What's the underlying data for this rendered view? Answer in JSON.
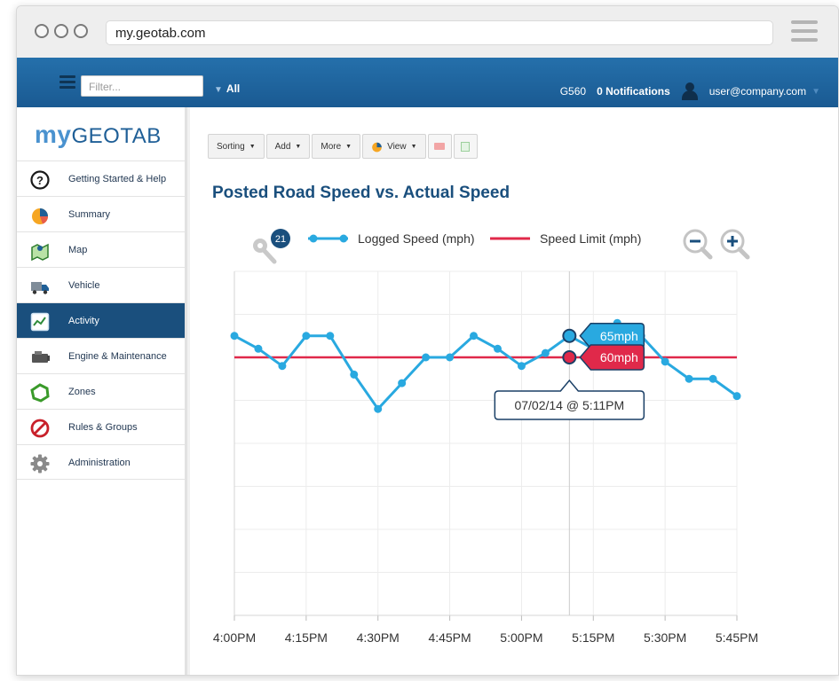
{
  "browser": {
    "url": "my.geotab.com"
  },
  "appbar": {
    "filter_placeholder": "Filter...",
    "group_label": "All",
    "device": "G560",
    "notifications": "0 Notifications",
    "user": "user@company.com"
  },
  "sidebar": {
    "logo_my": "my",
    "logo_name": "GEOTAB",
    "items": [
      {
        "label": "Getting Started & Help",
        "icon": "help-icon"
      },
      {
        "label": "Summary",
        "icon": "pie-chart-icon"
      },
      {
        "label": "Map",
        "icon": "map-icon"
      },
      {
        "label": "Vehicle",
        "icon": "truck-icon"
      },
      {
        "label": "Activity",
        "icon": "activity-chart-icon",
        "active": true
      },
      {
        "label": "Engine & Maintenance",
        "icon": "engine-icon"
      },
      {
        "label": "Zones",
        "icon": "zone-icon"
      },
      {
        "label": "Rules & Groups",
        "icon": "prohibited-icon"
      },
      {
        "label": "Administration",
        "icon": "gear-icon"
      }
    ]
  },
  "toolbar": {
    "sorting": "Sorting",
    "add": "Add",
    "more": "More",
    "view": "View"
  },
  "colors": {
    "accent": "#1a4f7d",
    "logged_speed": "#29a9e0",
    "speed_limit": "#e0294a"
  },
  "chart_data": {
    "type": "line",
    "title": "Posted Road Speed vs. Actual Speed",
    "badge_count": "21",
    "x_tick_labels": [
      "4:00PM",
      "4:15PM",
      "4:30PM",
      "4:45PM",
      "5:00PM",
      "5:15PM",
      "5:30PM",
      "5:45PM"
    ],
    "x_range_minutes": [
      0,
      105
    ],
    "ylim": [
      0,
      80
    ],
    "grid": true,
    "legend_position": "top",
    "series": [
      {
        "name": "Logged Speed (mph)",
        "color": "#29a9e0",
        "x": [
          0,
          5,
          10,
          15,
          20,
          25,
          30,
          35,
          40,
          45,
          50,
          55,
          60,
          65,
          70,
          75,
          80,
          85,
          90,
          95,
          100,
          105
        ],
        "y": [
          65,
          62,
          58,
          65,
          65,
          56,
          48,
          54,
          60,
          60,
          65,
          62,
          58,
          61,
          65,
          62,
          68,
          65,
          59,
          55,
          55,
          51
        ]
      },
      {
        "name": "Speed Limit (mph)",
        "color": "#e0294a",
        "x": [
          0,
          105
        ],
        "y": [
          60,
          60
        ]
      }
    ],
    "cursor": {
      "x": 70,
      "logged_label": "65mph",
      "limit_label": "60mph",
      "time_label": "07/02/14 @ 5:11PM"
    }
  }
}
